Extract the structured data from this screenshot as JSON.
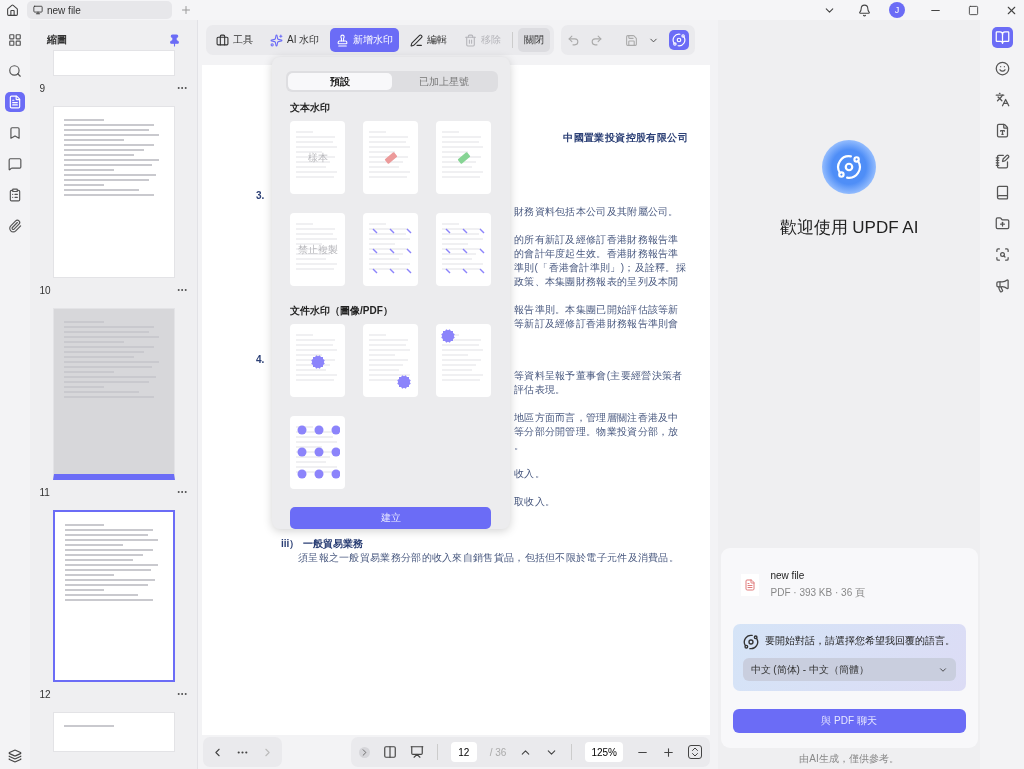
{
  "tab_bar": {
    "tab": "new file",
    "avatar": "J"
  },
  "left_rail": {
    "items": [
      {
        "selected": false
      },
      {
        "selected": false
      },
      {
        "selected": true
      },
      {
        "selected": false
      },
      {
        "selected": false
      },
      {
        "selected": false
      },
      {
        "selected": false
      }
    ]
  },
  "thumbnails": {
    "title": "縮圖",
    "pages": [
      {
        "label": "9",
        "selected": false,
        "highlighted": false
      },
      {
        "label": "10",
        "selected": false,
        "highlighted": false
      },
      {
        "label": "11",
        "selected": false,
        "highlighted": true
      },
      {
        "label": "12",
        "selected": true,
        "highlighted": false
      }
    ]
  },
  "toolbar": {
    "tools": "工具",
    "actions": [
      {
        "label": "AI 水印",
        "selected": false,
        "disabled": false
      },
      {
        "label": "新增水印",
        "selected": true,
        "disabled": false
      },
      {
        "label": "編輯",
        "selected": false,
        "disabled": false
      },
      {
        "label": "移除",
        "selected": false,
        "disabled": true
      }
    ],
    "close": "關閉"
  },
  "document": {
    "heading": "中國置業投資控股有限公司",
    "sections": [
      {
        "marker": "3.",
        "paragraphs": [
          [
            "財務資料包括本公司及其附屬公司。"
          ],
          [
            "的所有新訂及經修訂香港財務報告準",
            "的會計年度起生效。香港財務報告準",
            "準則(「香港會計準則」)；及詮釋。採",
            "政策、本集團財務報表的呈列及本閒"
          ],
          [
            "報告準則。本集團已開始評估該等新",
            "等新訂及經修訂香港財務報告準則會"
          ]
        ]
      },
      {
        "marker": "4.",
        "paragraphs": [
          [
            "等資料呈報予董事會(主要經營決策者",
            "評估表現。"
          ],
          [
            "地區方面而言，管理層關注香港及中",
            "等分部分開管理。物業投資分部，放",
            "。"
          ],
          [
            "收入。"
          ],
          [
            "取收入。"
          ]
        ]
      }
    ],
    "subsection": {
      "marker": "iii）",
      "title": "一般貿易業務",
      "text": "須呈報之一般貿易業務分部的收入來自銷售貨品，包括但不限於電子元件及消費品。"
    }
  },
  "watermark_popup": {
    "tabs": [
      {
        "label": "預設",
        "selected": true
      },
      {
        "label": "已加上星號",
        "selected": false
      }
    ],
    "text_section": "文本水印",
    "text_watermarks": [
      {
        "kind": "text",
        "label": "樣本"
      },
      {
        "kind": "stamp",
        "color": "#ec9a9a"
      },
      {
        "kind": "stamp",
        "color": "#86d494"
      },
      {
        "kind": "text",
        "label": "禁止複製"
      },
      {
        "kind": "pattern"
      },
      {
        "kind": "pattern"
      }
    ],
    "file_section": "文件水印（圖像/PDF）",
    "file_watermarks": [
      {
        "kind": "image"
      },
      {
        "kind": "image"
      },
      {
        "kind": "image"
      },
      {
        "kind": "tiled"
      }
    ],
    "create_button": "建立"
  },
  "page_nav": {
    "page": "12",
    "total": "/ 36",
    "zoom": "125%"
  },
  "ai_panel": {
    "title": "歡迎使用 UPDF AI",
    "file_name": "new file",
    "file_meta": "PDF · 393 KB · 36 頁",
    "prompt": "要開始對話，請選擇您希望我回覆的語言。",
    "language": "中文 (简体) - 中文（簡體）",
    "chat_button": "與 PDF 聊天",
    "disclaimer": "由AI生成，僅供參考。"
  },
  "right_rail": {
    "items": [
      {
        "selected": true
      },
      {
        "selected": false
      },
      {
        "selected": false
      },
      {
        "selected": false
      },
      {
        "selected": false
      },
      {
        "selected": false
      },
      {
        "selected": false
      },
      {
        "selected": false
      },
      {
        "selected": false
      }
    ]
  }
}
